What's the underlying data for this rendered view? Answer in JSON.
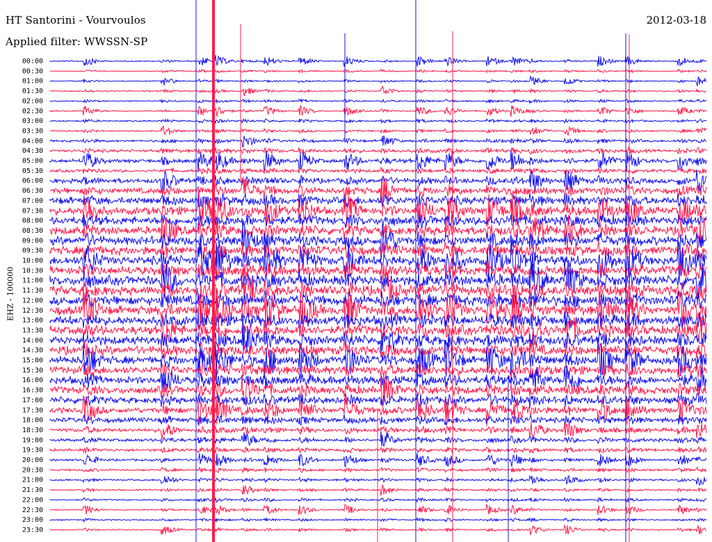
{
  "header": {
    "title": "HT Santorini - Vourvoulos",
    "filter": "Applied filter: WWSSN-SP",
    "date": "2012-03-18"
  },
  "chart_data": {
    "type": "line",
    "title": "HT Santorini - Vourvoulos",
    "subtitle": "Applied filter: WWSSN-SP",
    "date": "2012-03-18",
    "ylabel": "EHZ - 100000",
    "xlabel": "",
    "row_interval_minutes": 30,
    "tick_labels": [
      "00:00",
      "00:30",
      "01:00",
      "01:30",
      "02:00",
      "02:30",
      "03:00",
      "03:30",
      "04:00",
      "04:30",
      "05:00",
      "05:30",
      "06:00",
      "06:30",
      "07:00",
      "07:30",
      "08:00",
      "08:30",
      "09:00",
      "09:30",
      "10:00",
      "10:30",
      "11:00",
      "11:30",
      "12:00",
      "12:30",
      "13:00",
      "13:30",
      "14:00",
      "14:30",
      "15:00",
      "15:30",
      "16:00",
      "16:30",
      "17:00",
      "17:30",
      "18:00",
      "18:30",
      "19:00",
      "19:30",
      "20:00",
      "20:30",
      "21:00",
      "21:30",
      "22:00",
      "22:30",
      "23:00",
      "23:30"
    ],
    "trace_colors": [
      "#1010ee",
      "#ff1a4b"
    ],
    "amplitude_by_row": [
      0.5,
      0.4,
      0.4,
      0.5,
      0.5,
      0.5,
      0.6,
      0.6,
      0.9,
      1.2,
      1.6,
      1.2,
      2.0,
      2.5,
      3.0,
      3.2,
      3.3,
      3.4,
      3.5,
      3.6,
      3.7,
      3.8,
      3.9,
      4.0,
      4.0,
      3.9,
      3.8,
      3.7,
      3.6,
      3.5,
      3.4,
      3.3,
      3.2,
      3.0,
      2.7,
      2.4,
      2.0,
      1.6,
      1.3,
      1.1,
      0.9,
      0.8,
      0.7,
      0.6,
      0.6,
      0.5,
      0.5,
      0.5
    ],
    "grid": false,
    "legend": "none"
  }
}
